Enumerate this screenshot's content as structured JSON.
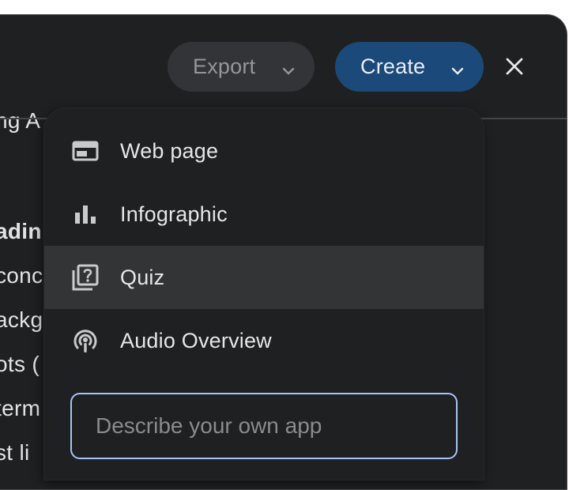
{
  "toolbar": {
    "export_label": "Export",
    "create_label": "Create",
    "close_icon": "close-icon"
  },
  "background_text": [
    "ng A",
    "adin",
    "conc",
    "ackg",
    "ots (",
    "term",
    "st li"
  ],
  "create_menu": {
    "items": [
      {
        "label": "Web page",
        "icon": "web-page-icon",
        "selected": false
      },
      {
        "label": "Infographic",
        "icon": "bar-chart-icon",
        "selected": false
      },
      {
        "label": "Quiz",
        "icon": "quiz-icon",
        "selected": true
      },
      {
        "label": "Audio Overview",
        "icon": "podcast-icon",
        "selected": false
      }
    ],
    "describe_input": {
      "placeholder": "Describe your own app",
      "value": ""
    }
  },
  "colors": {
    "panel_bg": "#1f2022",
    "create_accent": "#1b4a7a",
    "input_focus_border": "#a8c4f5",
    "selected_row": "#323436"
  }
}
